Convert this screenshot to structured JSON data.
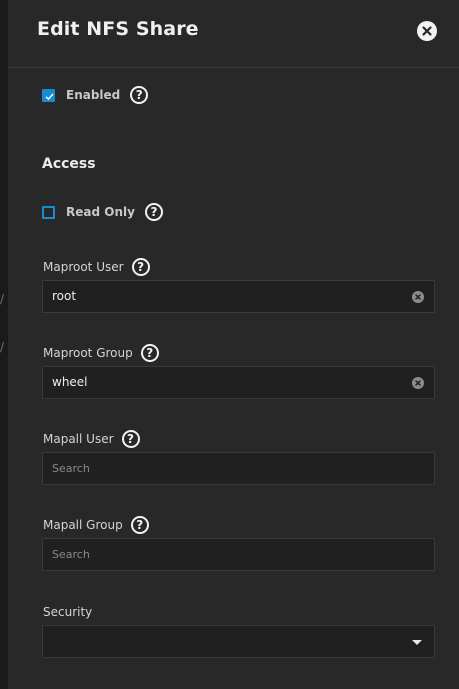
{
  "header": {
    "title": "Edit NFS Share",
    "close_icon": "close-icon"
  },
  "enabled": {
    "label": "Enabled",
    "checked": true,
    "help_glyph": "?"
  },
  "access": {
    "title": "Access",
    "read_only": {
      "label": "Read Only",
      "checked": false,
      "help_glyph": "?"
    },
    "maproot_user": {
      "label": "Maproot User",
      "value": "root",
      "help_glyph": "?"
    },
    "maproot_group": {
      "label": "Maproot Group",
      "value": "wheel",
      "help_glyph": "?"
    },
    "mapall_user": {
      "label": "Mapall User",
      "placeholder": "Search",
      "help_glyph": "?"
    },
    "mapall_group": {
      "label": "Mapall Group",
      "placeholder": "Search",
      "help_glyph": "?"
    },
    "security": {
      "label": "Security",
      "value": ""
    }
  },
  "background": {
    "glyph_1": "/",
    "glyph_2": "/"
  },
  "colors": {
    "accent": "#1a8ad1",
    "panel_bg": "#282828",
    "field_bg": "#202020"
  }
}
